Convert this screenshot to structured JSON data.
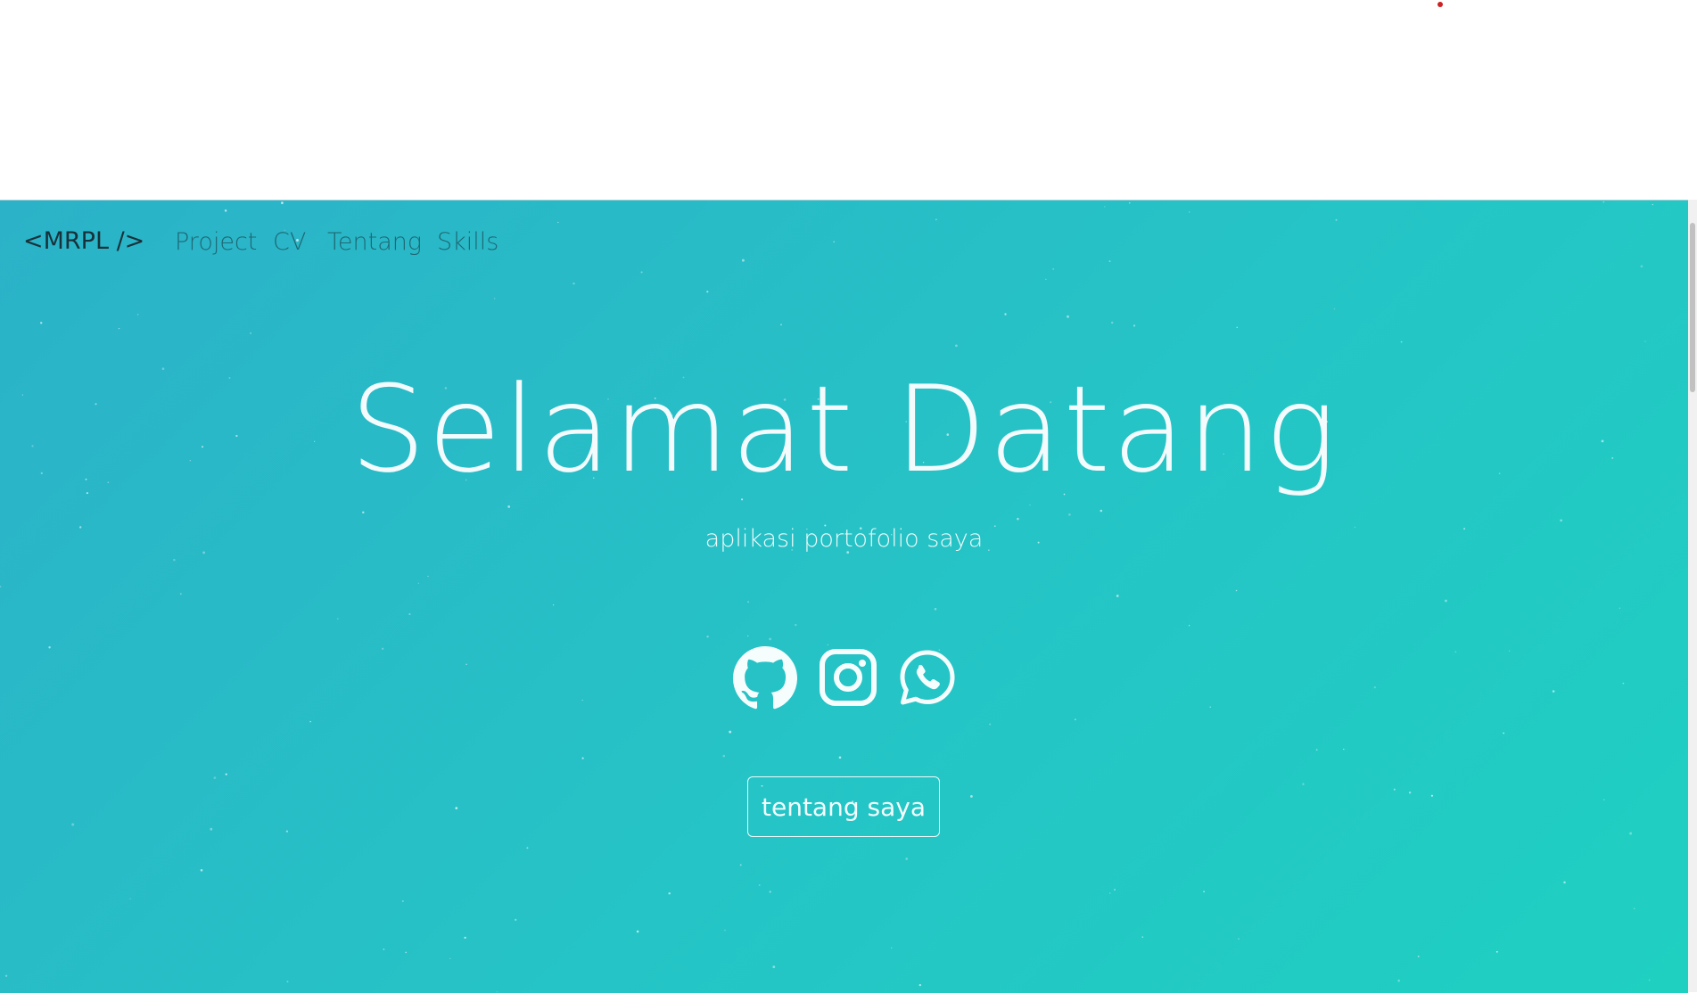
{
  "colors": {
    "gradient_start": "#2bb2c8",
    "gradient_end": "#1fd0c1",
    "text_light": "#f3fbfc",
    "brand_text": "#17313a",
    "nav_text": "#1d5b66",
    "red_dot": "#cc2222"
  },
  "navbar": {
    "brand": "<MRPL />",
    "links": [
      "Project",
      "CV",
      "Tentang",
      "Skills"
    ]
  },
  "hero": {
    "title": "Selamat Datang",
    "subtitle": "aplikasi portofolio saya",
    "social_icons": [
      "github-icon",
      "instagram-icon",
      "whatsapp-icon"
    ],
    "cta_label": "tentang saya"
  }
}
